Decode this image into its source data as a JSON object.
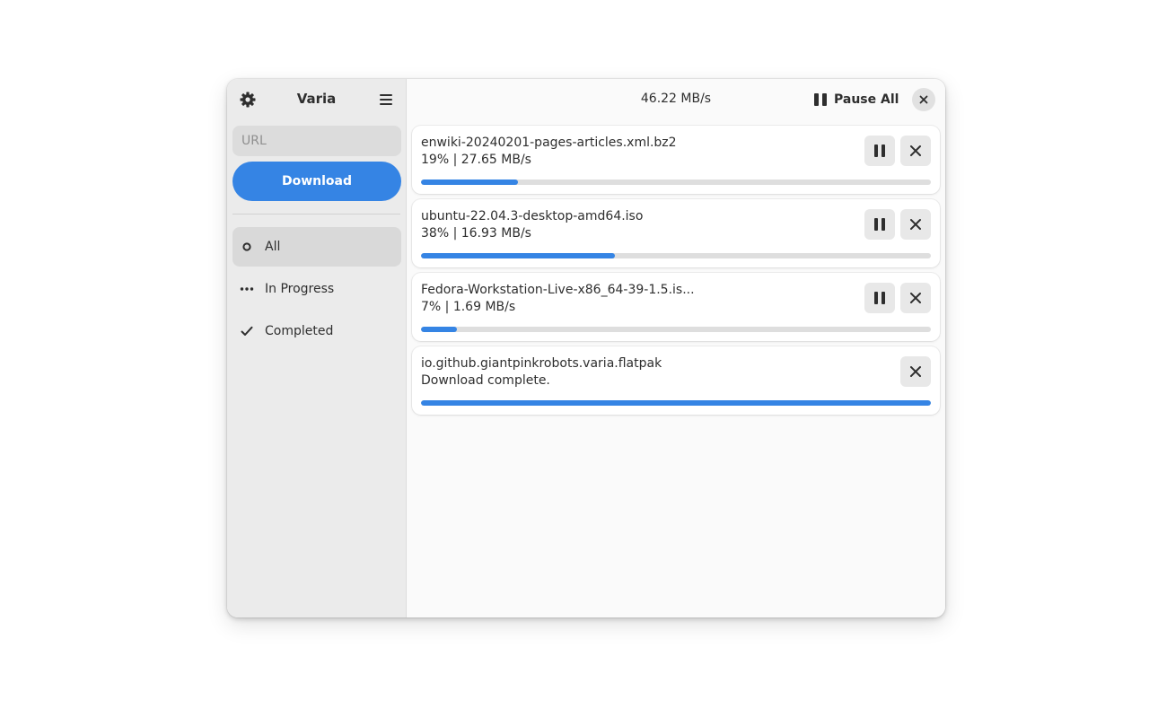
{
  "app": {
    "title": "Varia"
  },
  "sidebar": {
    "url_placeholder": "URL",
    "url_value": "",
    "download_label": "Download",
    "filters": [
      {
        "label": "All",
        "icon": "circle-outline-icon",
        "selected": true
      },
      {
        "label": "In Progress",
        "icon": "ellipsis-icon",
        "selected": false
      },
      {
        "label": "Completed",
        "icon": "checkmark-icon",
        "selected": false
      }
    ]
  },
  "header": {
    "total_speed": "46.22 MB/s",
    "pause_all_label": "Pause All"
  },
  "downloads": [
    {
      "filename": "enwiki-20240201-pages-articles.xml.bz2",
      "status": "19%  |  27.65 MB/s",
      "progress": 0.19,
      "paused_button": true
    },
    {
      "filename": "ubuntu-22.04.3-desktop-amd64.iso",
      "status": "38%  |  16.93 MB/s",
      "progress": 0.38,
      "paused_button": true
    },
    {
      "filename": "Fedora-Workstation-Live-x86_64-39-1.5.is...",
      "status": "7%  |  1.69 MB/s",
      "progress": 0.07,
      "paused_button": true
    },
    {
      "filename": "io.github.giantpinkrobots.varia.flatpak",
      "status": "Download complete.",
      "progress": 1.0,
      "paused_button": false
    }
  ],
  "colors": {
    "accent": "#3584e4",
    "sidebar_bg": "#ebebeb",
    "content_bg": "#fafafa"
  }
}
